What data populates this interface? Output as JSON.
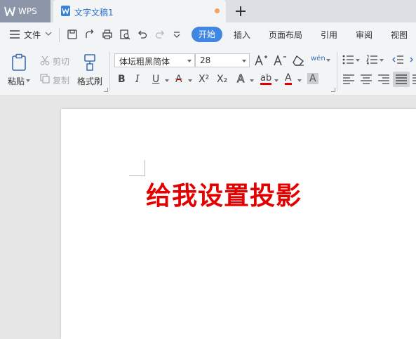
{
  "tabs": {
    "app_label": "WPS",
    "document_label": "文字文稿1"
  },
  "menu": {
    "file_label": "文件",
    "tabs": [
      "开始",
      "插入",
      "页面布局",
      "引用",
      "审阅",
      "视图"
    ]
  },
  "ribbon": {
    "paste_label": "粘贴",
    "cut_label": "剪切",
    "copy_label": "复制",
    "format_painter_label": "格式刷",
    "font_name": "体坛粗黑简体",
    "font_size": "28",
    "phonetic_glyph": "wén",
    "bold_glyph": "B",
    "italic_glyph": "I",
    "underline_glyph": "U",
    "strike_glyph": "A",
    "superscript_glyph": "X²",
    "subscript_glyph": "X₂",
    "effect_glyph": "A",
    "highlight_glyph": "ab",
    "font_color_glyph": "A",
    "char_shade_glyph": "A"
  },
  "document": {
    "body_text": "给我设置投影",
    "text_color": "#e50000"
  },
  "colors": {
    "accent": "#3f87e3",
    "wps_tab": "#8d96a8",
    "highlight_red": "#e50000",
    "unsaved_dot": "#f5a25d"
  }
}
